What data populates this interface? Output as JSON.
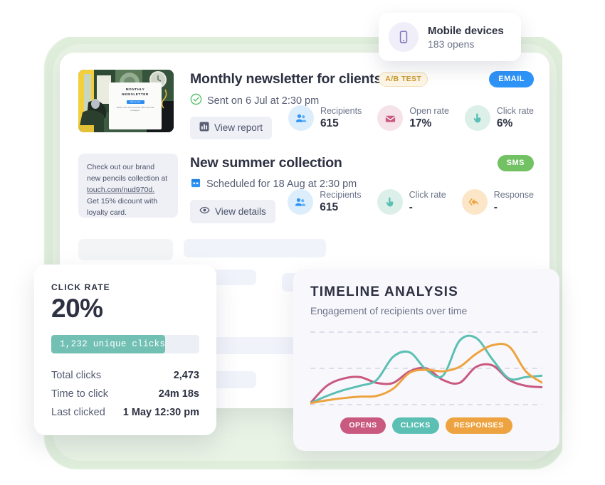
{
  "colors": {
    "backdrop_green": "#dfeedb",
    "email_badge": "#2e93f7",
    "sms_badge": "#72c163",
    "ab_badge_text": "#c99b2e",
    "teal": "#5cbfb4",
    "pink": "#c9597f",
    "orange": "#eda33f",
    "text_dark": "#2d3142",
    "text_muted": "#6d748a"
  },
  "mobile_card": {
    "icon": "mobile-phone-icon",
    "title": "Mobile devices",
    "subtitle": "183 opens"
  },
  "campaigns": [
    {
      "thumbnail": {
        "kind": "email-preview",
        "title": "MONTHLY NEWSLETTER",
        "button_label": "Sign up now",
        "caption": "Easily create and customise SMS and email campaigns."
      },
      "title": "Monthly newsletter for clients",
      "flag_badge": "A/B TEST",
      "type_badge": "EMAIL",
      "type_badge_kind": "email",
      "status_icon": "check-circle-icon",
      "status": "Sent on 6 Jul at 2:30 pm",
      "action_icon": "bar-chart-icon",
      "action_label": "View report",
      "stats": [
        {
          "icon": "people-icon",
          "label": "Recipients",
          "value": "615",
          "tint": "#dceefc",
          "color": "#2e93f7"
        },
        {
          "icon": "envelope-open-icon",
          "label": "Open rate",
          "value": "17%",
          "tint": "#f6e2e9",
          "color": "#c9597f"
        },
        {
          "icon": "click-hand-icon",
          "label": "Click rate",
          "value": "6%",
          "tint": "#dcefe9",
          "color": "#5cbfb4"
        }
      ]
    },
    {
      "thumbnail": {
        "kind": "sms-preview",
        "line1": "Check out our brand",
        "line2": "new pencils collection at",
        "link": "touch.com/nud970d.",
        "line3": "Get 15% dicount with",
        "line4": "loyalty card."
      },
      "title": "New summer collection",
      "flag_badge": "",
      "type_badge": "SMS",
      "type_badge_kind": "sms",
      "status_icon": "calendar-icon",
      "status": "Scheduled for 18 Aug at 2:30 pm",
      "action_icon": "eye-icon",
      "action_label": "View details",
      "stats": [
        {
          "icon": "people-icon",
          "label": "Recipients",
          "value": "615",
          "tint": "#dceefc",
          "color": "#2e93f7"
        },
        {
          "icon": "click-hand-icon",
          "label": "Click rate",
          "value": "-",
          "tint": "#dcefe9",
          "color": "#5cbfb4"
        },
        {
          "icon": "reply-arrow-icon",
          "label": "Response",
          "value": "-",
          "tint": "#fbe6c8",
          "color": "#eda33f"
        }
      ]
    }
  ],
  "click_rate_card": {
    "kicker": "CLICK RATE",
    "big_value": "20%",
    "bar_label": "1,232 unique clicks",
    "bar_fill_percent": 77,
    "rows": [
      {
        "label": "Total clicks",
        "value": "2,473"
      },
      {
        "label": "Time to click",
        "value": "24m 18s"
      },
      {
        "label": "Last clicked",
        "value": "1 May 12:30 pm"
      }
    ]
  },
  "timeline_card": {
    "title": "TIMELINE ANALYSIS",
    "subtitle": "Engagement of recipients over time",
    "legend": [
      {
        "label": "OPENS",
        "color": "#c9597f"
      },
      {
        "label": "CLICKS",
        "color": "#5cbfb4"
      },
      {
        "label": "RESPONSES",
        "color": "#eda33f"
      }
    ]
  },
  "chart_data": {
    "type": "line",
    "title": "TIMELINE ANALYSIS",
    "subtitle": "Engagement of recipients over time",
    "xlabel": "",
    "ylabel": "",
    "x": [
      0,
      1,
      2,
      3,
      4,
      5,
      6,
      7,
      8,
      9,
      10,
      11,
      12
    ],
    "ylim": [
      0,
      100
    ],
    "grid": "horizontal-dashed",
    "gridlines": [
      0,
      50,
      100
    ],
    "legend_position": "bottom-center",
    "series": [
      {
        "name": "OPENS",
        "color": "#c9597f",
        "values": [
          2,
          26,
          36,
          38,
          30,
          30,
          46,
          50,
          34,
          30,
          52,
          54,
          34,
          26,
          24
        ]
      },
      {
        "name": "CLICKS",
        "color": "#5cbfb4",
        "values": [
          2,
          12,
          20,
          26,
          34,
          66,
          72,
          48,
          40,
          88,
          92,
          62,
          36,
          38,
          40
        ]
      },
      {
        "name": "RESPONSES",
        "color": "#eda33f",
        "values": [
          2,
          6,
          9,
          11,
          12,
          22,
          44,
          48,
          46,
          52,
          70,
          82,
          80,
          46,
          30
        ]
      }
    ]
  }
}
